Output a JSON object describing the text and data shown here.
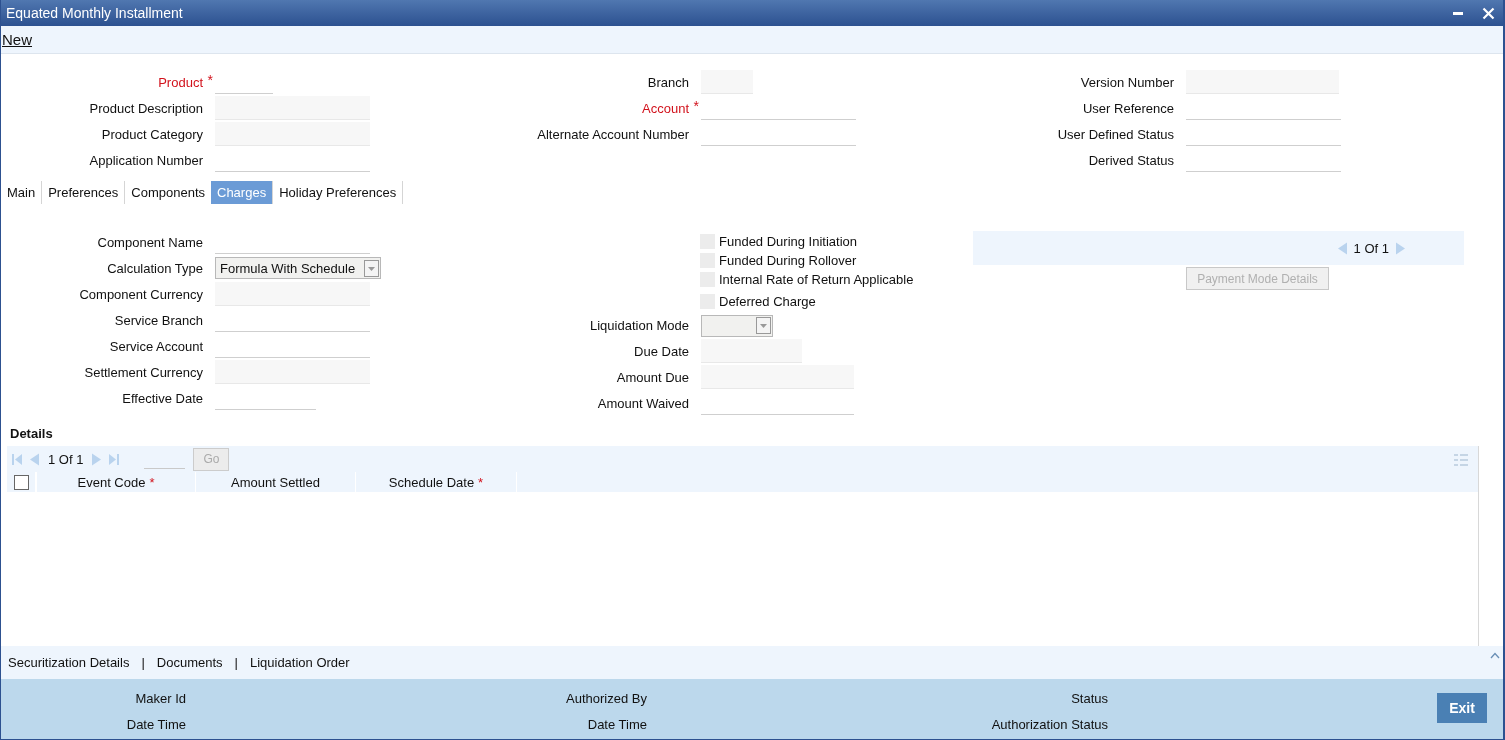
{
  "window": {
    "title": "Equated Monthly Installment"
  },
  "toolbar": {
    "link": "New"
  },
  "required_mark": "*",
  "header_columns": [
    [
      {
        "label": "Product",
        "required": true,
        "kind": "text"
      },
      {
        "label": "Product Description",
        "required": false,
        "kind": "readonly"
      },
      {
        "label": "Product Category",
        "required": false,
        "kind": "readonly"
      },
      {
        "label": "Application Number",
        "required": false,
        "kind": "text"
      }
    ],
    [
      {
        "label": "Branch",
        "required": false,
        "kind": "readonly"
      },
      {
        "label": "Account",
        "required": true,
        "kind": "text"
      },
      {
        "label": "Alternate Account Number",
        "required": false,
        "kind": "text"
      }
    ],
    [
      {
        "label": "Version Number",
        "required": false,
        "kind": "readonly"
      },
      {
        "label": "User Reference",
        "required": false,
        "kind": "text"
      },
      {
        "label": "User Defined Status",
        "required": false,
        "kind": "text"
      },
      {
        "label": "Derived Status",
        "required": false,
        "kind": "text"
      }
    ]
  ],
  "tabs": [
    {
      "label": "Main",
      "selected": false
    },
    {
      "label": "Preferences",
      "selected": false
    },
    {
      "label": "Components",
      "selected": false
    },
    {
      "label": "Charges",
      "selected": true
    },
    {
      "label": "Holiday Preferences",
      "selected": false
    }
  ],
  "charges": {
    "left_fields": [
      {
        "label": "Component Name",
        "required": false,
        "kind": "text"
      },
      {
        "label": "Calculation Type",
        "required": false,
        "kind": "select",
        "value": "Formula With Schedule"
      },
      {
        "label": "Component Currency",
        "required": false,
        "kind": "readonly"
      },
      {
        "label": "Service Branch",
        "required": false,
        "kind": "text"
      },
      {
        "label": "Service Account",
        "required": false,
        "kind": "text"
      },
      {
        "label": "Settlement Currency",
        "required": false,
        "kind": "readonly"
      },
      {
        "label": "Effective Date",
        "required": false,
        "kind": "text"
      }
    ],
    "checkboxes": [
      {
        "label": "Funded During Initiation",
        "checked": false
      },
      {
        "label": "Funded During Rollover",
        "checked": false
      },
      {
        "label": "Internal Rate of Return Applicable",
        "checked": false
      },
      {
        "label": "Deferred Charge",
        "checked": false
      }
    ],
    "right_fields": [
      {
        "label": "Liquidation Mode",
        "required": false,
        "kind": "select"
      },
      {
        "label": "Due Date",
        "required": false,
        "kind": "readonly"
      },
      {
        "label": "Amount Due",
        "required": false,
        "kind": "readonly"
      },
      {
        "label": "Amount Waived",
        "required": false,
        "kind": "text"
      }
    ],
    "pager": "1 Of 1",
    "button": {
      "label": "Payment Mode Details",
      "disabled": true
    }
  },
  "details": {
    "title": "Details",
    "pager": "1 Of 1",
    "go_button": "Go",
    "select_all_checked": false,
    "columns": [
      {
        "label": "Event Code",
        "required": true
      },
      {
        "label": "Amount Settled",
        "required": false
      },
      {
        "label": "Schedule Date",
        "required": true
      }
    ]
  },
  "bottom_links": {
    "separator": "|",
    "items": [
      "Securitization Details",
      "Documents",
      "Liquidation Order"
    ]
  },
  "audit": [
    [
      "Maker Id",
      "Date Time"
    ],
    [
      "Authorized By",
      "Date Time"
    ],
    [
      "Status",
      "Authorization Status"
    ]
  ],
  "exit_button": "Exit"
}
